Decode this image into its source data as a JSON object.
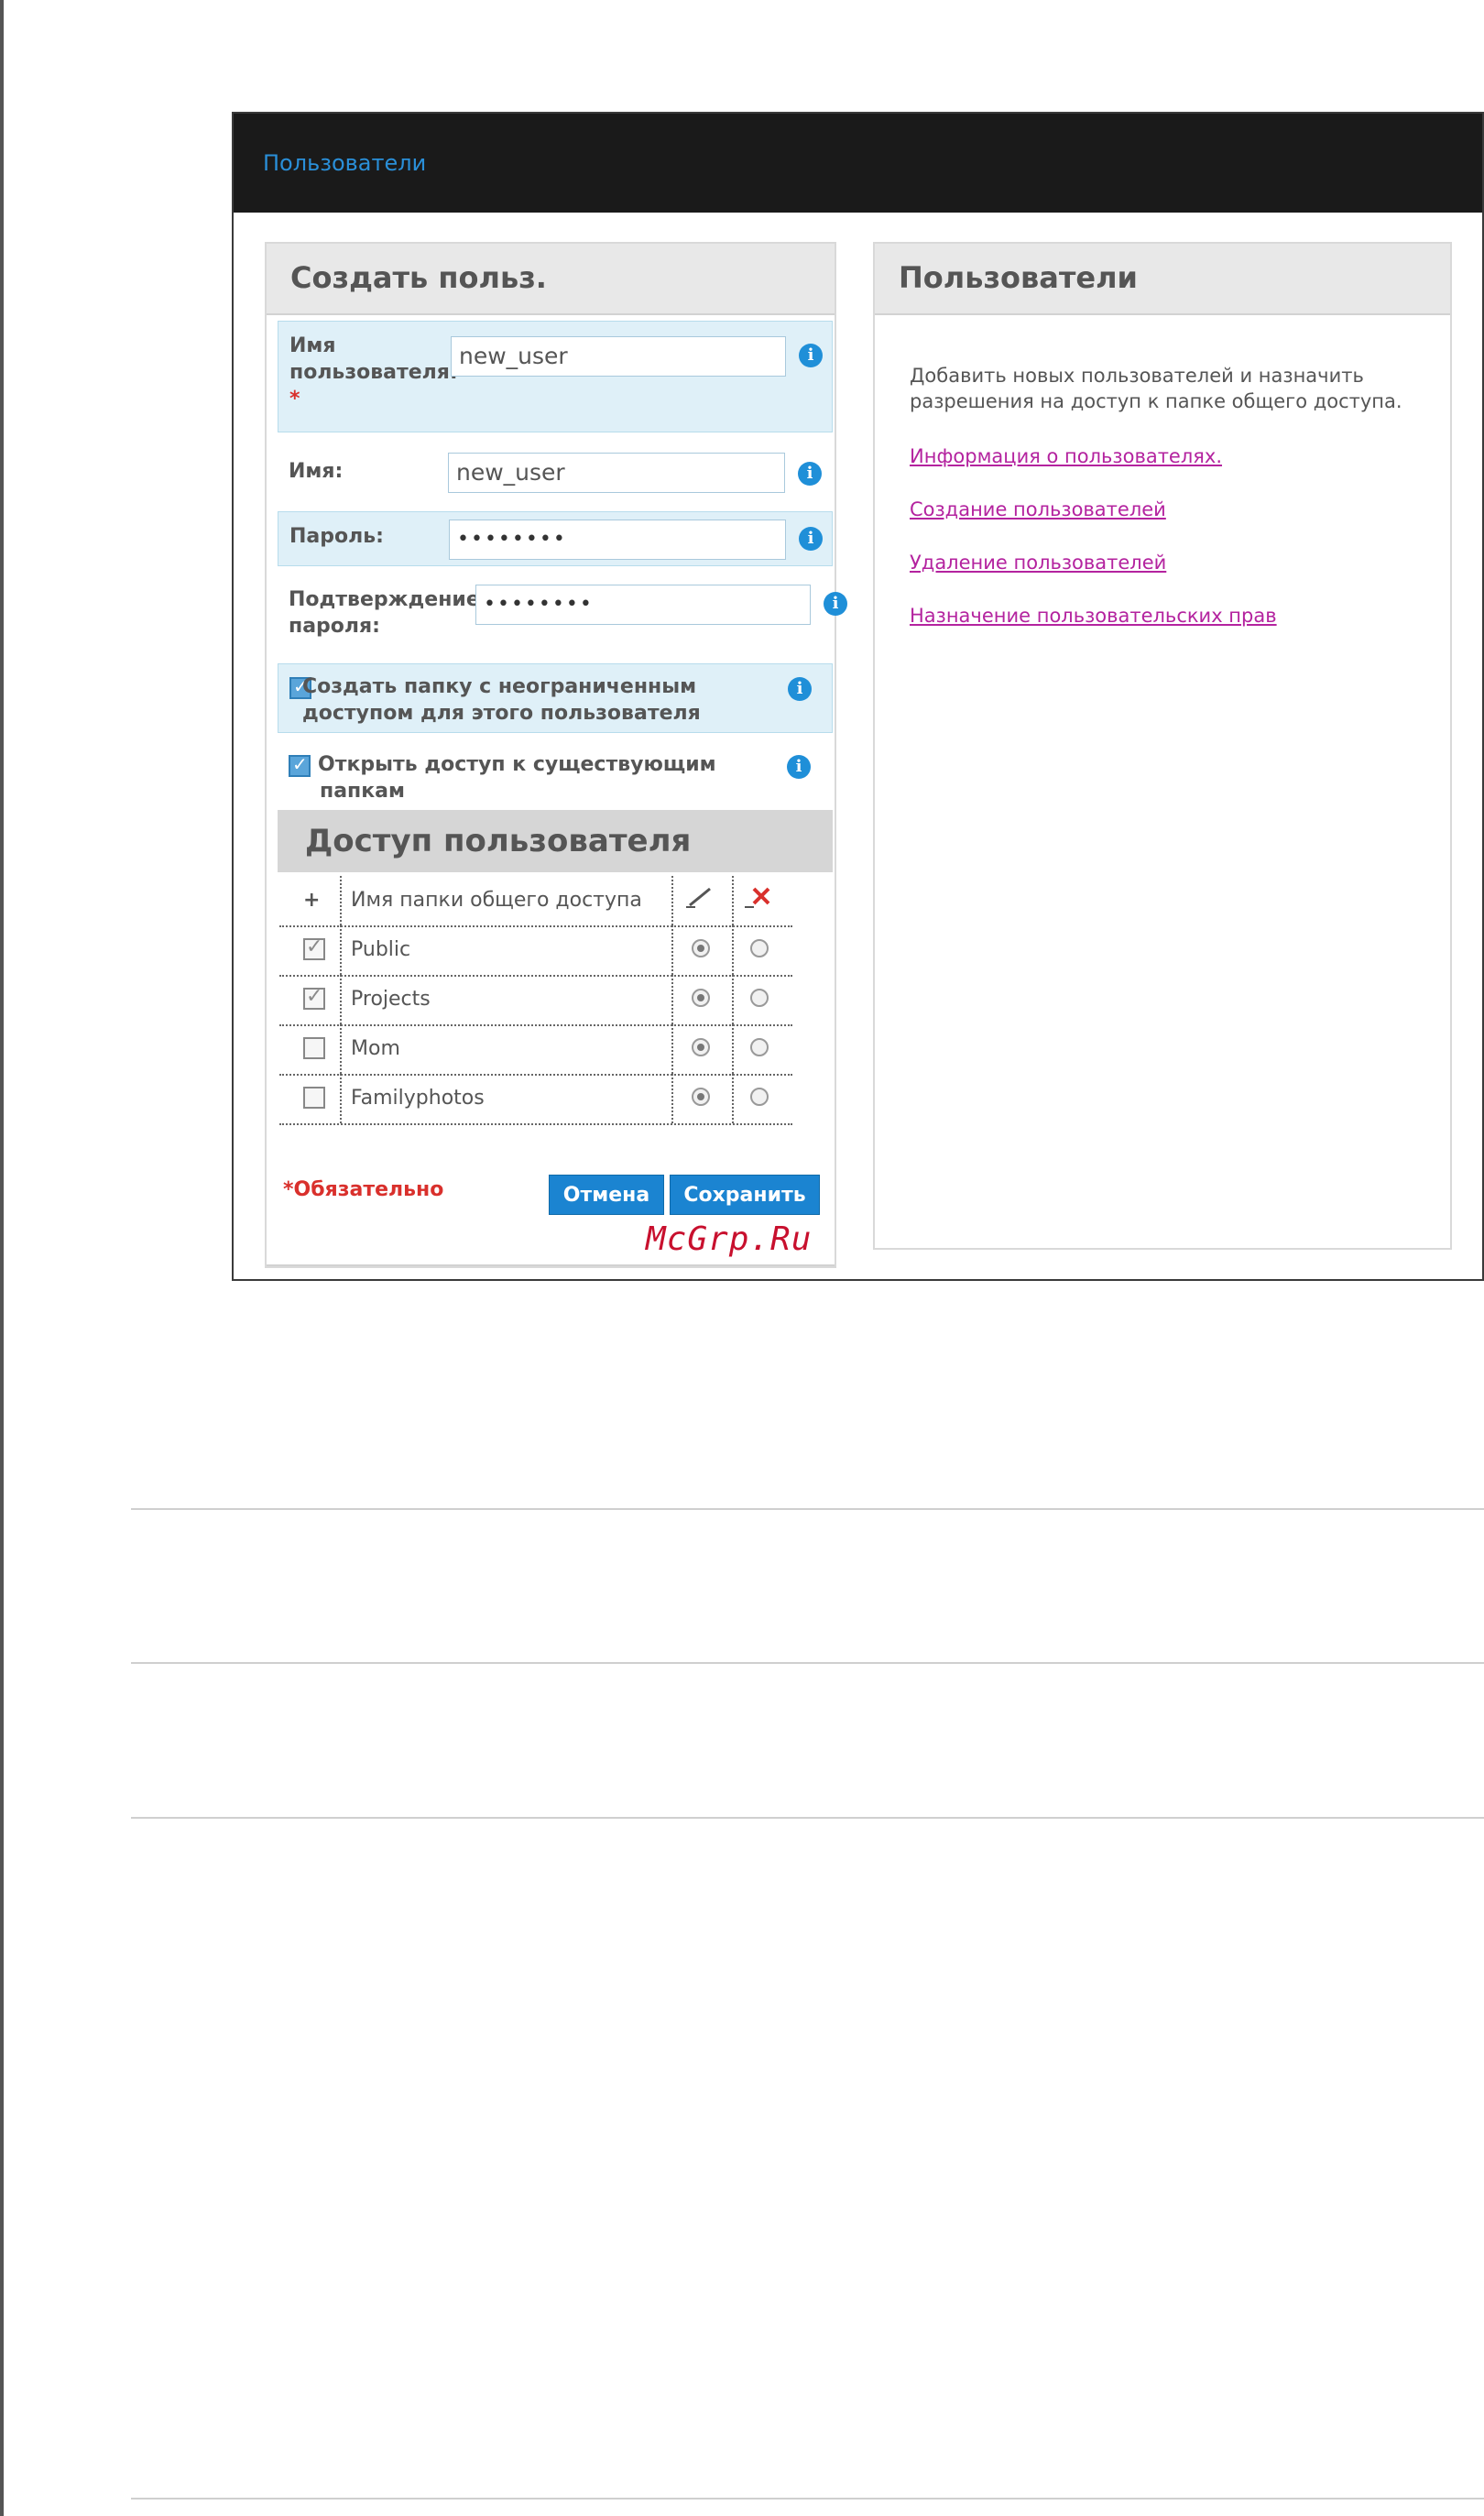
{
  "header": {
    "title": "Пользователи"
  },
  "create_panel": {
    "title": "Создать польз.",
    "username": {
      "label_line1": "Имя",
      "label_line2": "пользователя:",
      "required_mark": "*",
      "value": "new_user"
    },
    "name": {
      "label": "Имя:",
      "value": "new_user"
    },
    "password": {
      "label": "Пароль:",
      "value": "••••••••"
    },
    "confirm": {
      "label_line1": "Подтверждение",
      "label_line2": "пароля:",
      "value": "••••••••"
    },
    "create_folder": {
      "line1": "Создать папку с неограниченным",
      "line2": "доступом для этого пользователя",
      "checked": true
    },
    "share_existing": {
      "line1": "Открыть доступ к существующим",
      "line2": "папкам",
      "checked": true
    },
    "info_icon": "i"
  },
  "access": {
    "title": "Доступ пользователя",
    "columns": {
      "add": "+",
      "folder": "Имя папки общего доступа"
    },
    "rows": [
      {
        "folder": "Public",
        "checked": true,
        "access": "rw"
      },
      {
        "folder": "Projects",
        "checked": true,
        "access": "rw"
      },
      {
        "folder": "Mom",
        "checked": false,
        "access": "rw"
      },
      {
        "folder": "Familyphotos",
        "checked": false,
        "access": "rw"
      }
    ]
  },
  "footer": {
    "required_note": "*Обязательно",
    "cancel": "Отмена",
    "save": "Сохранить"
  },
  "users_panel": {
    "title": "Пользователи",
    "description": "Добавить новых пользователей и назначить разрешения на доступ к папке общего доступа.",
    "links": [
      "Информация о пользователях.",
      "Создание пользователей",
      "Удаление пользователей",
      "Назначение пользовательских прав"
    ]
  },
  "watermark": "McGrp.Ru",
  "icons": {
    "write_column": "pencil-icon",
    "deny_column": "red-x-icon",
    "info": "info-icon"
  },
  "colors": {
    "accent": "#1b84d1",
    "link": "#b4239f",
    "required": "#d9302c",
    "header_bg": "#1a1a1a"
  }
}
